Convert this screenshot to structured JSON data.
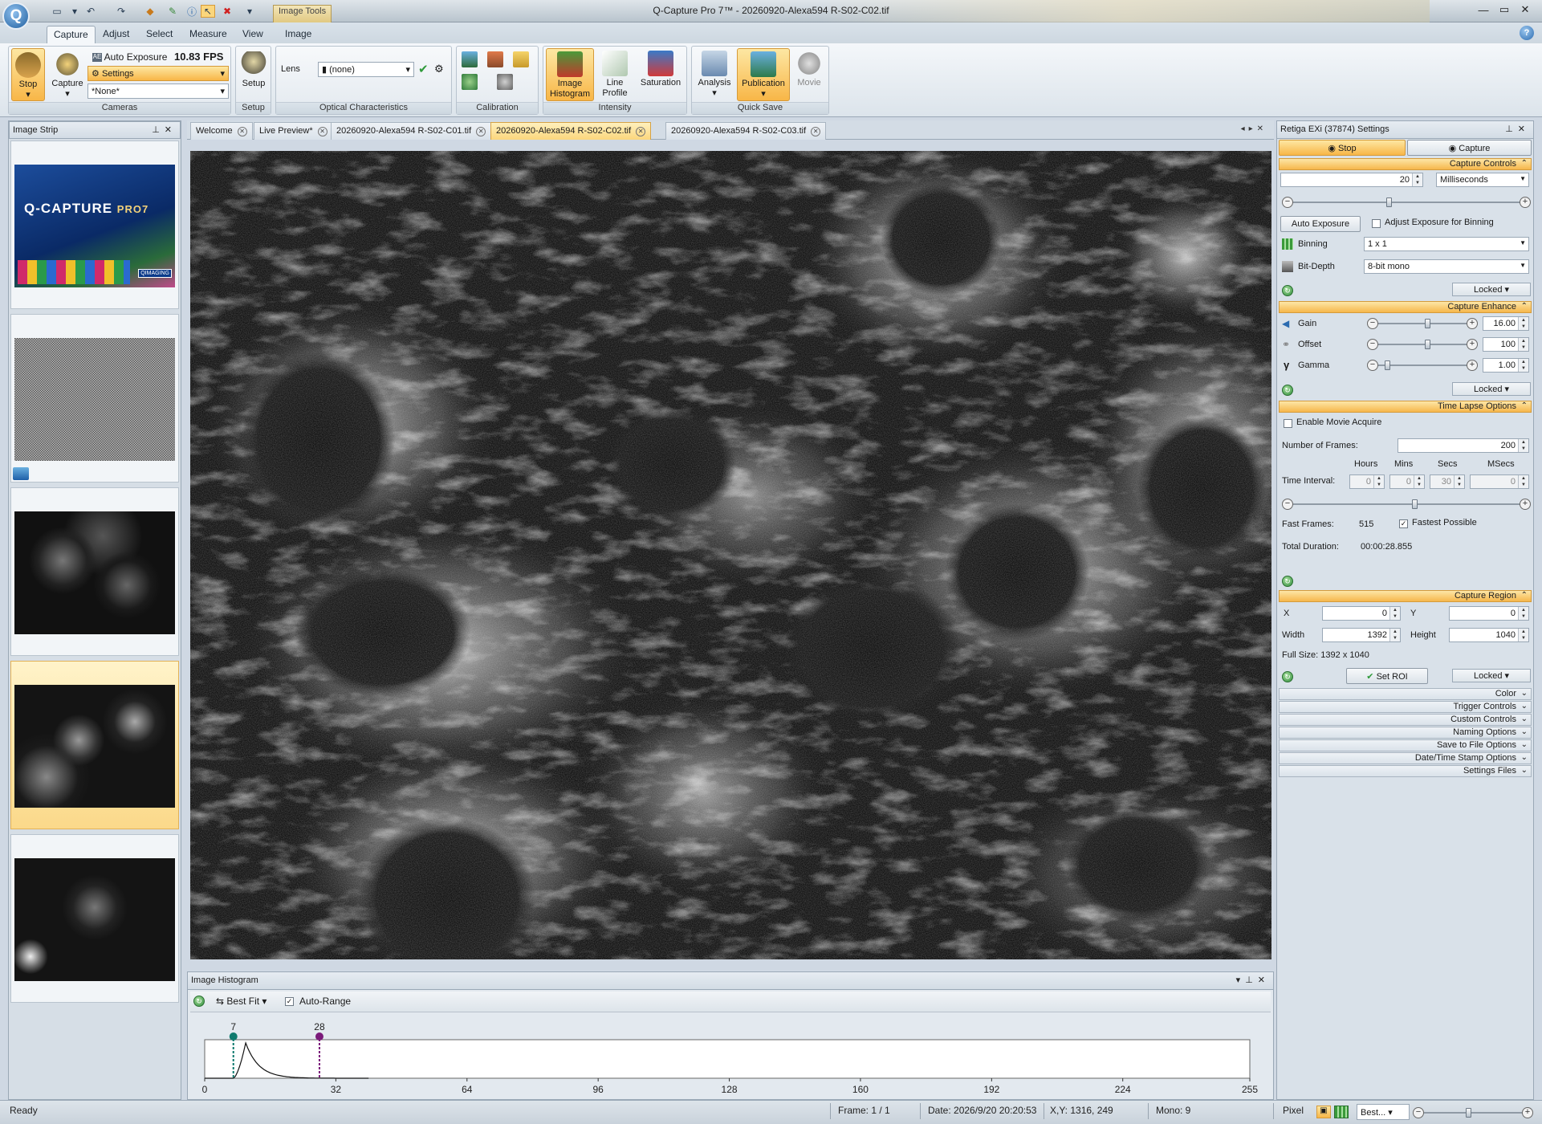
{
  "window": {
    "title": "Q-Capture Pro 7™ - 20260920-Alexa594 R-S02-C02.tif",
    "context_tab": "Image Tools"
  },
  "ribbon": {
    "tabs": [
      "Capture",
      "Adjust",
      "Select",
      "Measure",
      "View",
      "Image"
    ],
    "active_tab": "Capture",
    "cameras": {
      "stop": "Stop",
      "capture": "Capture",
      "auto_exposure": "Auto Exposure",
      "fps": "10.83 FPS",
      "settings": "Settings",
      "preset": "*None*",
      "label": "Cameras"
    },
    "setup": {
      "button": "Setup",
      "label": "Setup"
    },
    "optical": {
      "lens_label": "Lens",
      "lens_value": "(none)",
      "label": "Optical Characteristics"
    },
    "calibration": {
      "label": "Calibration"
    },
    "intensity": {
      "histogram": "Image Histogram",
      "line_profile": "Line Profile",
      "saturation": "Saturation",
      "label": "Intensity"
    },
    "quicksave": {
      "analysis": "Analysis",
      "publication": "Publication",
      "movie": "Movie",
      "label": "Quick Save"
    }
  },
  "image_strip": {
    "title": "Image Strip"
  },
  "doc_tabs": [
    "Welcome",
    "Live Preview*",
    "20260920-Alexa594 R-S02-C01.tif",
    "20260920-Alexa594 R-S02-C02.tif",
    "20260920-Alexa594 R-S02-C03.tif"
  ],
  "active_doc": "20260920-Alexa594 R-S02-C02.tif",
  "splash": {
    "brand": "Q-CAPTURE",
    "version": "PRO7",
    "logo": "QIMAGING"
  },
  "histogram": {
    "title": "Image Histogram",
    "fit_mode": "Best Fit",
    "auto_range": "Auto-Range",
    "low_marker": "7",
    "high_marker": "28",
    "ticks": [
      "0",
      "32",
      "64",
      "96",
      "128",
      "160",
      "192",
      "224",
      "255"
    ],
    "low_value": 7,
    "high_value": 28,
    "peak_value": 10,
    "max": 255
  },
  "settings": {
    "title": "Retiga EXi (37874) Settings",
    "stop_btn": "Stop",
    "capture_btn": "Capture",
    "capture_controls": {
      "header": "Capture Controls",
      "exposure": "20",
      "unit": "Milliseconds",
      "auto_exposure": "Auto Exposure",
      "adjust_binning": "Adjust Exposure for Binning",
      "binning_label": "Binning",
      "binning": "1 x 1",
      "bitdepth_label": "Bit-Depth",
      "bitdepth": "8-bit mono",
      "locked": "Locked"
    },
    "capture_enhance": {
      "header": "Capture Enhance",
      "gain_label": "Gain",
      "gain": "16.00",
      "offset_label": "Offset",
      "offset": "100",
      "gamma_label": "Gamma",
      "gamma": "1.00",
      "locked": "Locked"
    },
    "time_lapse": {
      "header": "Time Lapse Options",
      "enable_movie": "Enable Movie Acquire",
      "frames_label": "Number of Frames:",
      "frames": "200",
      "hours": "Hours",
      "mins": "Mins",
      "secs": "Secs",
      "msecs": "MSecs",
      "interval_label": "Time Interval:",
      "h_val": "0",
      "m_val": "0",
      "s_val": "30",
      "ms_val": "0",
      "fast_frames_label": "Fast Frames:",
      "fast_frames": "515",
      "fastest": "Fastest Possible",
      "duration_label": "Total Duration:",
      "duration": "00:00:28.855"
    },
    "capture_region": {
      "header": "Capture Region",
      "x_label": "X",
      "x": "0",
      "y_label": "Y",
      "y": "0",
      "w_label": "Width",
      "w": "1392",
      "h_label": "Height",
      "h": "1040",
      "full_size": "Full Size: 1392 x 1040",
      "set_roi": "Set ROI",
      "locked": "Locked"
    },
    "collapsed": [
      "Color",
      "Trigger Controls",
      "Custom Controls",
      "Naming Options",
      "Save to File Options",
      "Date/Time Stamp Options",
      "Settings Files"
    ]
  },
  "status": {
    "ready": "Ready",
    "frame": "Frame: 1 / 1",
    "date": "Date: 2026/9/20 20:20:53",
    "xy": "X,Y: 1316,  249",
    "mono": "Mono:     9",
    "pixel": "Pixel",
    "zoom": "Best..."
  },
  "colors": {
    "accent": "#f8b647",
    "selection": "#fbd67c",
    "ribbon": "#dce4eb"
  }
}
